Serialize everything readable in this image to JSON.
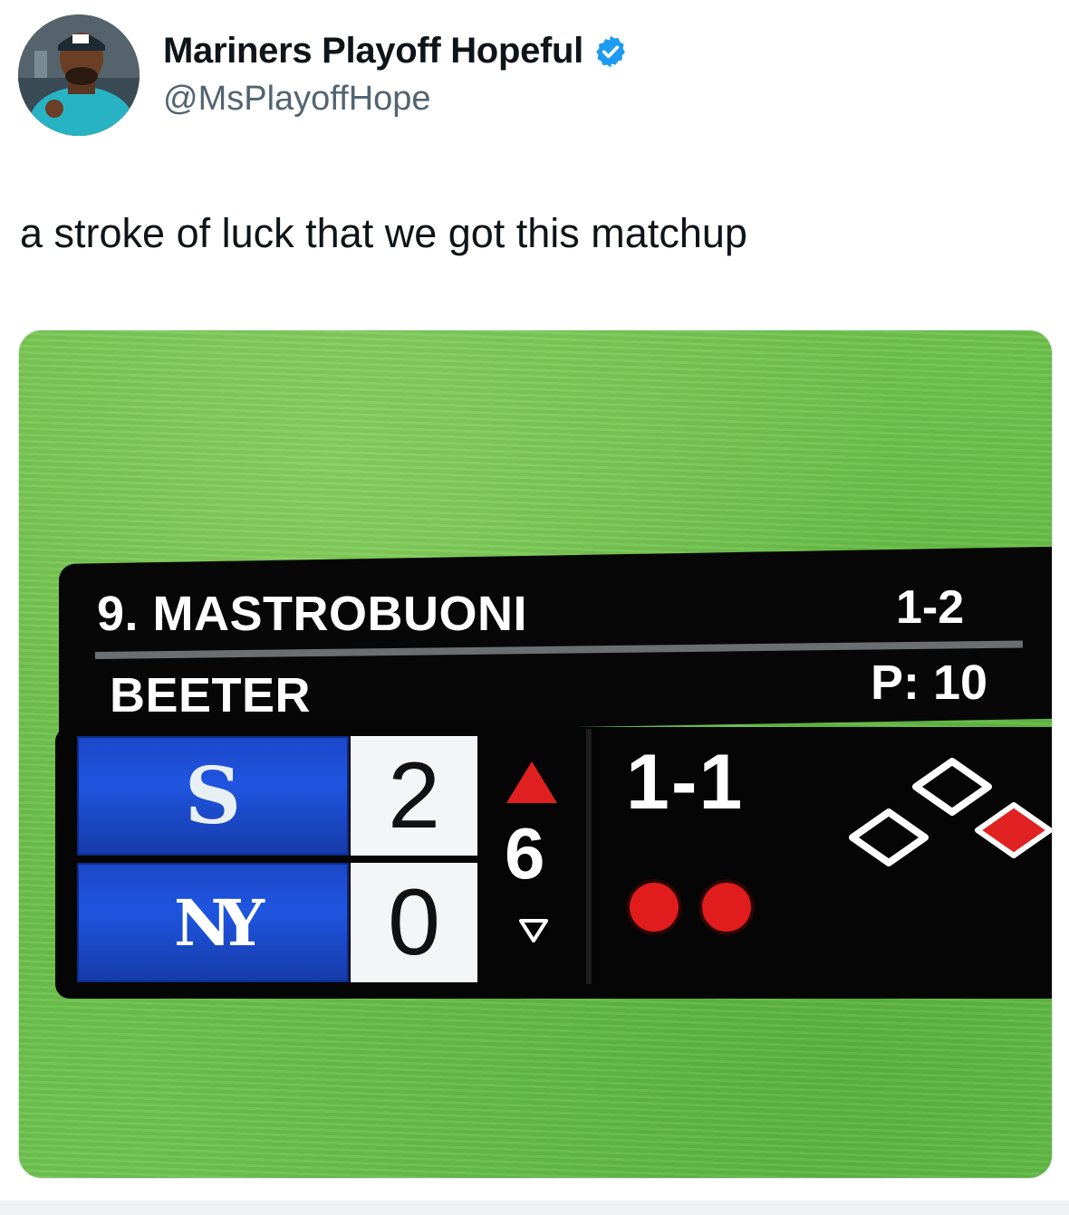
{
  "tweet": {
    "display_name": "Mariners Playoff Hopeful",
    "handle": "@MsPlayoffHope",
    "text": "a stroke of luck that we got this matchup",
    "verified_icon": "verified-badge-icon",
    "accent_color": "#1d9bf0"
  },
  "scorebug": {
    "batter": "9. MASTROBUONI",
    "batter_stat": "1-2",
    "pitcher": "BEETER",
    "pitch_count": "P: 10",
    "teams": [
      {
        "logo": "S",
        "logo_icon": "mariners-logo-icon",
        "score": "2"
      },
      {
        "logo": "NY",
        "logo_icon": "yankees-logo-icon",
        "score": "0"
      }
    ],
    "inning": "6",
    "inning_half": "top",
    "count": "1-1",
    "outs": 2,
    "bases": {
      "first": false,
      "second": false,
      "third": true
    }
  }
}
